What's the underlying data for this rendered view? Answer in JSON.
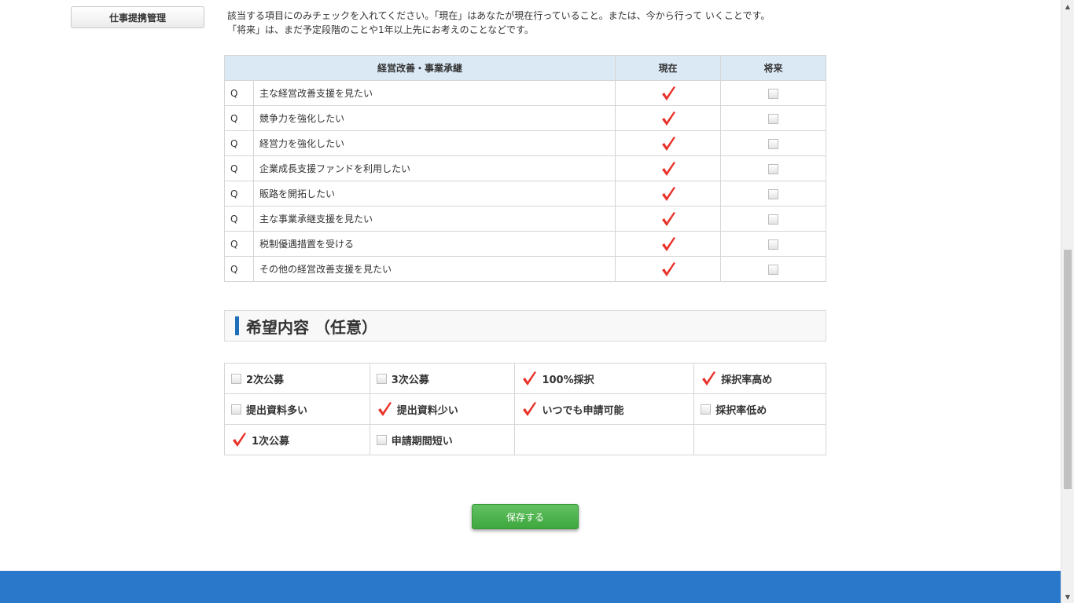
{
  "sidebar": {
    "button_label": "仕事提携管理"
  },
  "intro": {
    "line1": "該当する項目にのみチェックを入れてください。「現在」はあなたが現在行っていること。または、今から行って いくことです。",
    "line2": "「将来」は、まだ予定段階のことや1年以上先にお考えのことなどです。"
  },
  "question_table": {
    "header_topic": "経営改善・事業承継",
    "header_current": "現在",
    "header_future": "将来",
    "rows": [
      {
        "q": "Q",
        "label": "主な経営改善支援を見たい",
        "current": true,
        "future": false
      },
      {
        "q": "Q",
        "label": "競争力を強化したい",
        "current": true,
        "future": false
      },
      {
        "q": "Q",
        "label": "経営力を強化したい",
        "current": true,
        "future": false
      },
      {
        "q": "Q",
        "label": "企業成長支援ファンドを利用したい",
        "current": true,
        "future": false
      },
      {
        "q": "Q",
        "label": "販路を開拓したい",
        "current": true,
        "future": false
      },
      {
        "q": "Q",
        "label": "主な事業承継支援を見たい",
        "current": true,
        "future": false
      },
      {
        "q": "Q",
        "label": "税制優遇措置を受ける",
        "current": true,
        "future": false
      },
      {
        "q": "Q",
        "label": "その他の経営改善支援を見たい",
        "current": true,
        "future": false
      }
    ]
  },
  "wishes": {
    "title": "希望内容 （任意）",
    "rows": [
      [
        {
          "label": "2次公募",
          "checked": false
        },
        {
          "label": "3次公募",
          "checked": false
        },
        {
          "label": "100%採択",
          "checked": true
        },
        {
          "label": "採択率高め",
          "checked": true
        }
      ],
      [
        {
          "label": "提出資料多い",
          "checked": false
        },
        {
          "label": "提出資料少い",
          "checked": true
        },
        {
          "label": "いつでも申請可能",
          "checked": true
        },
        {
          "label": "採択率低め",
          "checked": false
        }
      ],
      [
        {
          "label": "1次公募",
          "checked": true
        },
        {
          "label": "申請期間短い",
          "checked": false
        }
      ]
    ]
  },
  "save_button": "保存する",
  "colors": {
    "header_bg": "#dbe9f5",
    "check_red": "#e8332a",
    "save_green": "#4cae4c",
    "footer_blue": "#2a78c9",
    "section_bar": "#1f6fb8"
  }
}
